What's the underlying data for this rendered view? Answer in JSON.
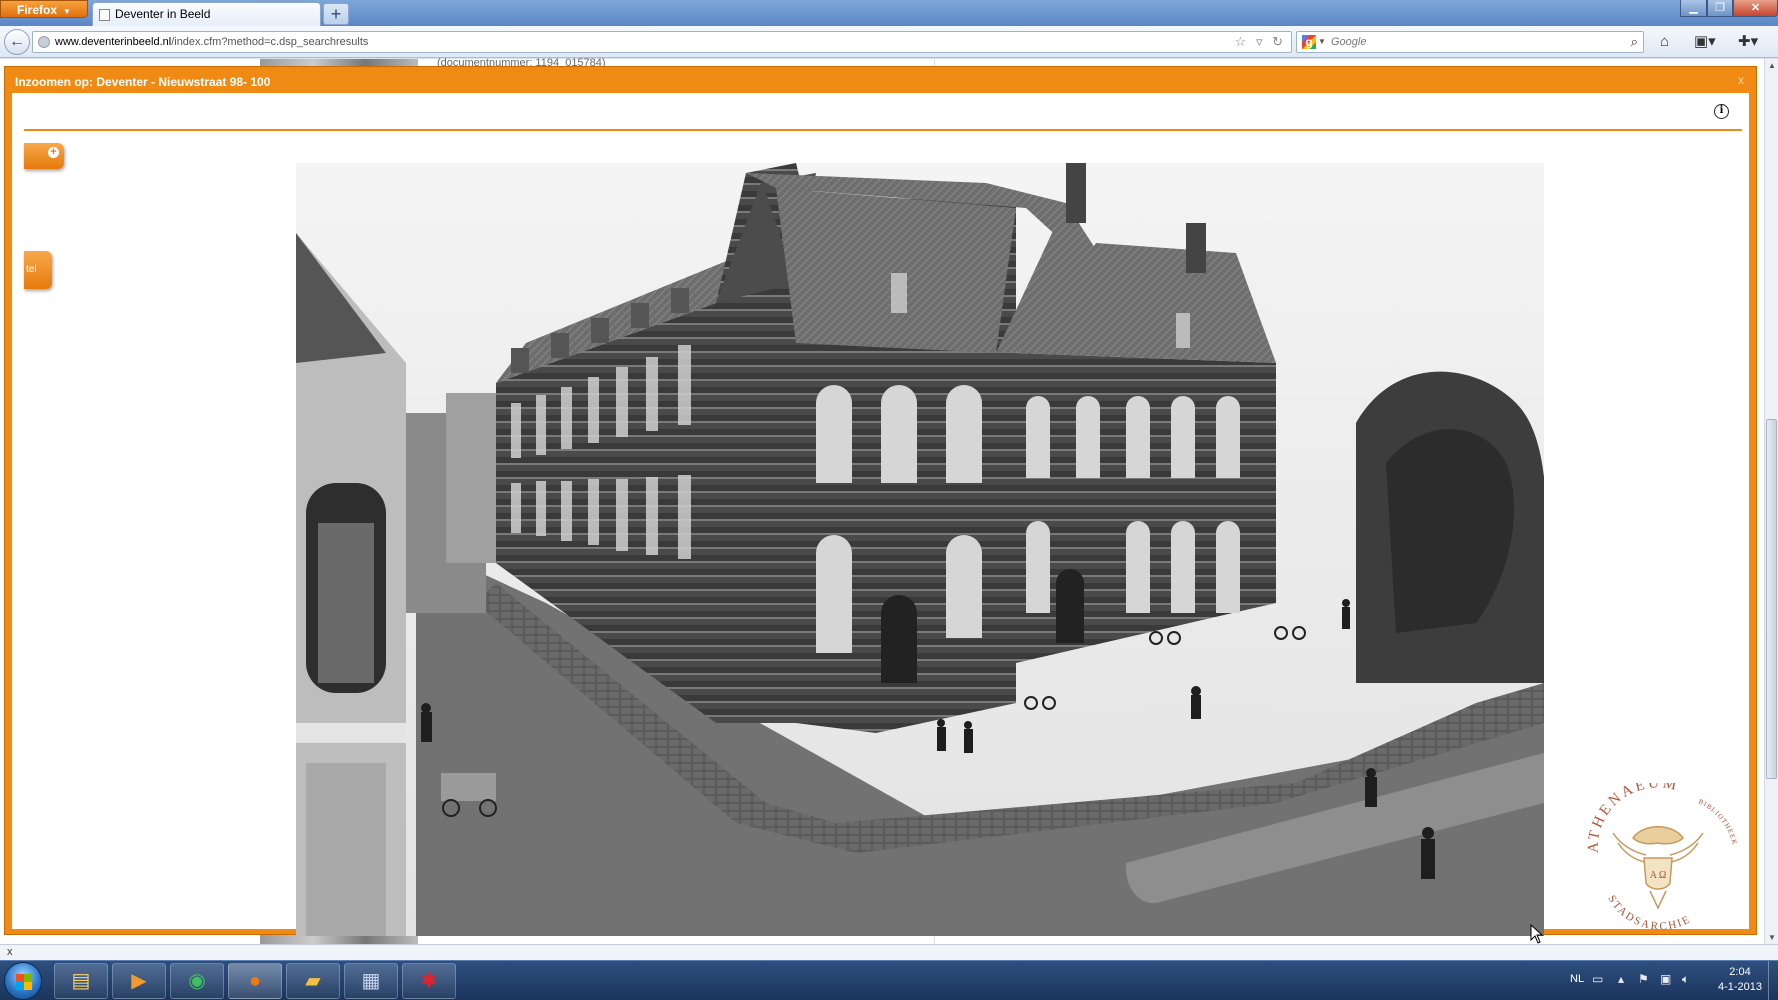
{
  "browser": {
    "app_button_label": "Firefox",
    "tab_title": "Deventer in Beeld",
    "new_tab_label": "+",
    "url_domain": "www.deventerinbeeld.nl",
    "url_path": "/index.cfm?method=c.dsp_searchresults",
    "search_engine_placeholder": "Google",
    "window_controls": [
      "minimize-icon",
      "maximize-icon",
      "close-icon"
    ]
  },
  "page_behind": {
    "document_number": "(documentnummer: 1194_015784)"
  },
  "overlay": {
    "title": "Inzoomen op: Deventer - Nieuwstraat 98- 100",
    "close_label": "x",
    "info_icon": "info-icon",
    "side_tab_label": "tel",
    "accent_color": "#ef8a14"
  },
  "photo": {
    "subject": "historic-building-photo",
    "tone": "black-and-white"
  },
  "logo": {
    "text_top": "ATHENAEUM",
    "text_right": "BIBLIOTHEEK",
    "text_bottom": "STADSARCHIEF",
    "shield_letters": "A Ω",
    "color": "#b0543a"
  },
  "addon_bar": {
    "close_label": "x"
  },
  "taskbar": {
    "apps": [
      "windows-explorer-icon",
      "media-player-icon",
      "green-app-icon",
      "firefox-icon",
      "folder-icon",
      "save-icon",
      "paint-icon"
    ],
    "language": "NL",
    "time": "2:04",
    "date": "4-1-2013"
  }
}
